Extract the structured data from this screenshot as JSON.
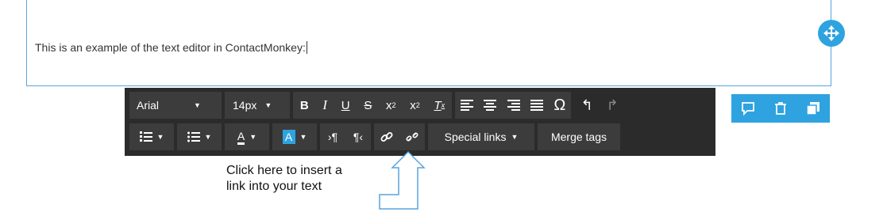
{
  "editor": {
    "text": "This is an example of the text editor in ContactMonkey:"
  },
  "toolbar": {
    "font_family": "Arial",
    "font_size": "14px",
    "special_links_label": "Special links",
    "merge_tags_label": "Merge tags",
    "omega_glyph": "Ω"
  },
  "annotation": {
    "line1": "Click here to insert a",
    "line2": "link into your text"
  },
  "colors": {
    "accent": "#2ea3e0",
    "toolbar_bg": "#2b2b2b",
    "button_bg": "#3c3c3c",
    "frame": "#5aa4dc"
  }
}
